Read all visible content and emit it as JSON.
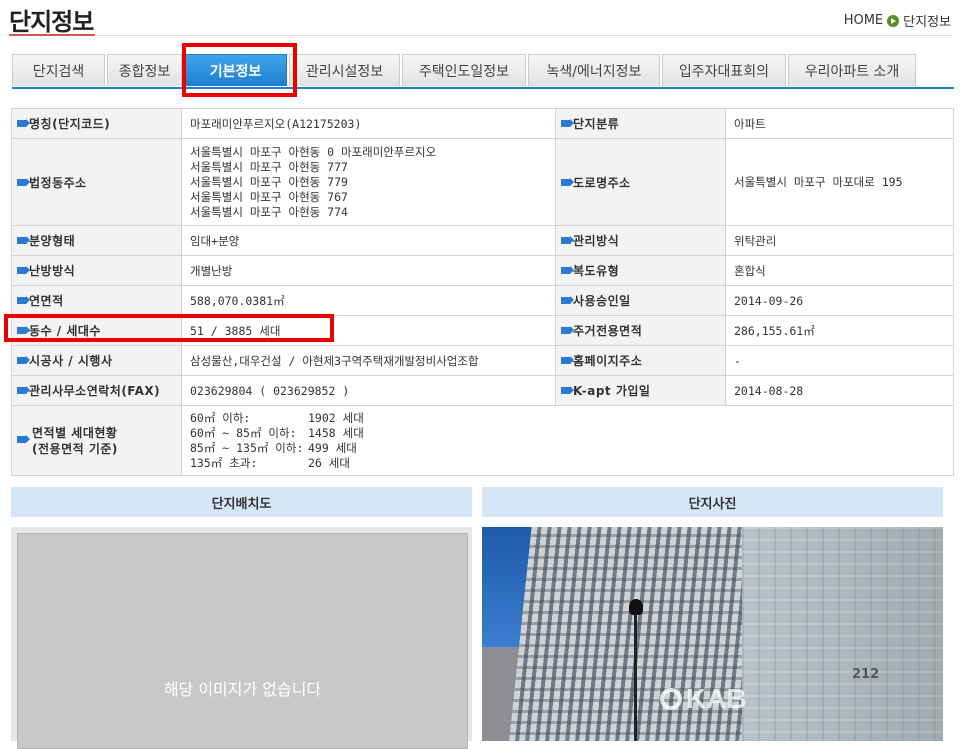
{
  "header": {
    "title": "단지정보",
    "breadcrumb": {
      "home": "HOME",
      "current": "단지정보"
    }
  },
  "tabs": [
    {
      "label": "단지검색",
      "active": false
    },
    {
      "label": "종합정보",
      "active": false
    },
    {
      "label": "기본정보",
      "active": true
    },
    {
      "label": "관리시설정보",
      "active": false
    },
    {
      "label": "주택인도일정보",
      "active": false
    },
    {
      "label": "녹색/에너지정보",
      "active": false
    },
    {
      "label": "입주자대표회의",
      "active": false
    },
    {
      "label": "우리아파트 소개",
      "active": false
    }
  ],
  "info": {
    "name_label": "명칭(단지코드)",
    "name_value": "마포래미안푸르지오(A12175203)",
    "category_label": "단지분류",
    "category_value": "아파트",
    "lot_addr_label": "법정동주소",
    "lot_addr_lines": [
      "서울특별시 마포구 아현동 0 마포래미안푸르지오",
      "서울특별시 마포구 아현동 777",
      "서울특별시 마포구 아현동 779",
      "서울특별시 마포구 아현동 767",
      "서울특별시 마포구 아현동 774"
    ],
    "road_addr_label": "도로명주소",
    "road_addr_value": "서울특별시 마포구 마포대로 195",
    "sale_type_label": "분양형태",
    "sale_type_value": "임대+분양",
    "mgmt_type_label": "관리방식",
    "mgmt_type_value": "위탁관리",
    "heating_label": "난방방식",
    "heating_value": "개별난방",
    "corridor_label": "복도유형",
    "corridor_value": "혼합식",
    "floor_area_label": "연면적",
    "floor_area_value": "588,070.0381㎡",
    "approval_label": "사용승인일",
    "approval_value": "2014-09-26",
    "buildings_label": "동수 / 세대수",
    "buildings_value": "51 / 3885 세대",
    "exclusive_area_label": "주거전용면적",
    "exclusive_area_value": "286,155.61㎡",
    "builder_label": "시공사 / 시행사",
    "builder_value": "삼성물산,대우건설 / 아현제3구역주택재개발정비사업조합",
    "homepage_label": "홈페이지주소",
    "homepage_value": "-",
    "office_label": "관리사무소연락처(FAX)",
    "office_value": "023629804 ( 023629852 )",
    "kapt_label": "K-apt 가입일",
    "kapt_value": "2014-08-28",
    "area_dist_label_1": "면적별 세대현황",
    "area_dist_label_2": "(전용면적 기준)",
    "area_dist": [
      {
        "range": "60㎡ 이하:",
        "count": "1902 세대"
      },
      {
        "range": "60㎡ ~ 85㎡ 이하:",
        "count": "1458 세대"
      },
      {
        "range": "85㎡ ~ 135㎡ 이하:",
        "count": "499 세대"
      },
      {
        "range": "135㎡ 초과:",
        "count": "26 세대"
      }
    ]
  },
  "panels": {
    "layout_title": "단지배치도",
    "layout_empty": "해당 이미지가 없습니다",
    "photo_title": "단지사진",
    "photo_watermark": "KAB",
    "photo_building_number": "212"
  },
  "colors": {
    "accent_blue": "#1e7fcf",
    "highlight_red": "#e00000",
    "panel_head_bg": "#d5e6f6"
  }
}
